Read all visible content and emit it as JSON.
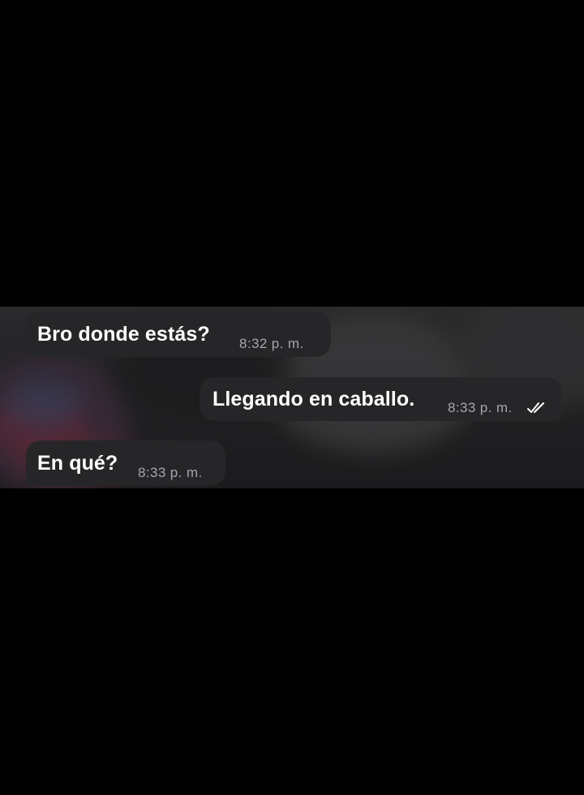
{
  "messages": [
    {
      "direction": "incoming",
      "text": "Bro donde estás?",
      "time": "8:32 p. m."
    },
    {
      "direction": "outgoing",
      "text": "Llegando en caballo.",
      "time": "8:33 p. m.",
      "status_icon": "double-check-icon"
    },
    {
      "direction": "incoming",
      "text": "En qué?",
      "time": "8:33 p. m."
    }
  ],
  "colors": {
    "background": "#000000",
    "bubble": "#262628",
    "message_text": "#ffffff",
    "time_text": "#a6a6aa"
  }
}
